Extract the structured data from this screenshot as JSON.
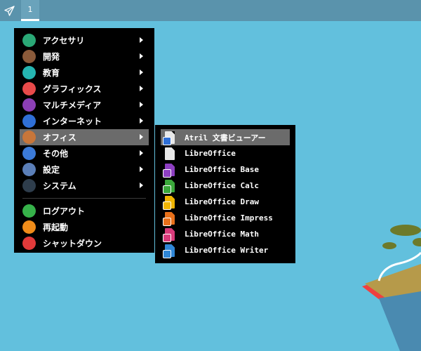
{
  "taskbar": {
    "launcher_icon": "paper-plane-icon",
    "workspace_label": "1"
  },
  "main_menu": {
    "items": [
      {
        "label": "アクセサリ",
        "icon": "accessories-icon",
        "color": "#2aa876",
        "submenu": true
      },
      {
        "label": "開発",
        "icon": "hammer-icon",
        "color": "#8a5a3a",
        "submenu": true
      },
      {
        "label": "教育",
        "icon": "atom-icon",
        "color": "#25b5b1",
        "submenu": true
      },
      {
        "label": "グラフィックス",
        "icon": "flower-icon",
        "color": "#e84a4a",
        "submenu": true
      },
      {
        "label": "マルチメディア",
        "icon": "multimedia-icon",
        "color": "#8b3fb5",
        "submenu": true
      },
      {
        "label": "インターネット",
        "icon": "globe-icon",
        "color": "#2f6fd6",
        "submenu": true
      },
      {
        "label": "オフィス",
        "icon": "briefcase-icon",
        "color": "#c7763a",
        "submenu": true
      },
      {
        "label": "その他",
        "icon": "dots-icon",
        "color": "#3b7ad8",
        "submenu": true
      },
      {
        "label": "設定",
        "icon": "settings-icon",
        "color": "#5b7fb8",
        "submenu": true
      },
      {
        "label": "システム",
        "icon": "gear-icon",
        "color": "#2e3d4c",
        "submenu": true
      }
    ],
    "actions": [
      {
        "label": "ログアウト",
        "icon": "logout-icon",
        "color": "#36b24a"
      },
      {
        "label": "再起動",
        "icon": "restart-icon",
        "color": "#f08c1a"
      },
      {
        "label": "シャットダウン",
        "icon": "power-icon",
        "color": "#e23a3a"
      }
    ],
    "active_index": 6
  },
  "office_submenu": {
    "items": [
      {
        "label": "Atril 文書ビューアー",
        "icon": "document-viewer-icon",
        "color": "#e8e8e8",
        "badge": "#2f6fd6"
      },
      {
        "label": "LibreOffice",
        "icon": "libreoffice-icon",
        "color": "#e8e8e8",
        "badge": ""
      },
      {
        "label": "LibreOffice Base",
        "icon": "libreoffice-base-icon",
        "color": "#8e3fc2",
        "badge": "#8e3fc2"
      },
      {
        "label": "LibreOffice Calc",
        "icon": "libreoffice-calc-icon",
        "color": "#3aa83a",
        "badge": "#3aa83a"
      },
      {
        "label": "LibreOffice Draw",
        "icon": "libreoffice-draw-icon",
        "color": "#f0b400",
        "badge": "#f0b400"
      },
      {
        "label": "LibreOffice Impress",
        "icon": "libreoffice-impress-icon",
        "color": "#e8701a",
        "badge": "#e8701a"
      },
      {
        "label": "LibreOffice Math",
        "icon": "libreoffice-math-icon",
        "color": "#d93a7a",
        "badge": "#d93a7a"
      },
      {
        "label": "LibreOffice Writer",
        "icon": "libreoffice-writer-icon",
        "color": "#2f86d6",
        "badge": "#2f86d6"
      }
    ],
    "active_index": 0
  }
}
